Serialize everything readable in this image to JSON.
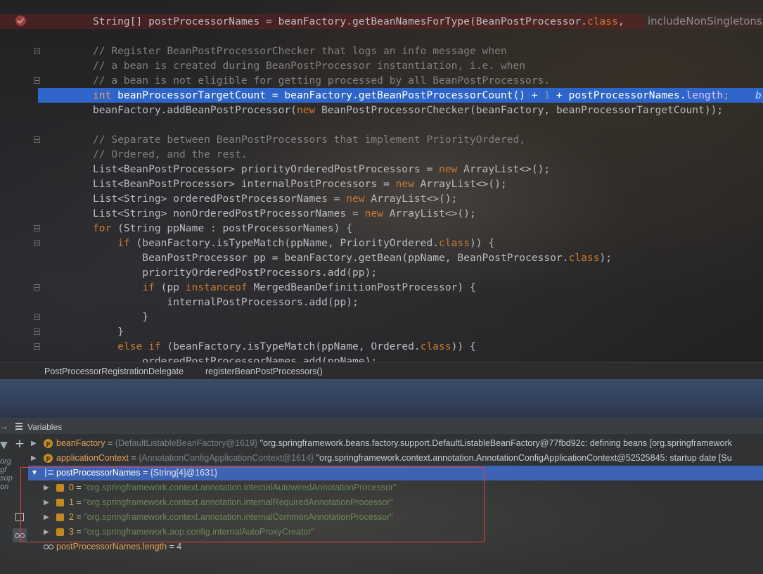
{
  "editor": {
    "lines": [
      {
        "segments": [
          {
            "t": "String[] postProcessorNames = beanFactory.getBeanNamesForType(BeanPostProcessor."
          },
          {
            "t": "class",
            "c": "kw"
          },
          {
            "t": ", "
          }
        ],
        "hint": "includeNonSingletons"
      },
      {
        "segments": []
      },
      {
        "segments": [
          {
            "t": "// Register BeanPostProcessorChecker that logs an info message when",
            "c": "cm"
          }
        ]
      },
      {
        "segments": [
          {
            "t": "// a bean is created during BeanPostProcessor instantiation, i.e. when",
            "c": "cm"
          }
        ]
      },
      {
        "segments": [
          {
            "t": "// a bean is not eligible for getting processed by all BeanPostProcessors.",
            "c": "cm"
          }
        ]
      },
      {
        "segments": [
          {
            "t": "int",
            "c": "kw"
          },
          {
            "t": " beanProcessorTargetCount = beanFactory.getBeanPostProcessorCount() + "
          },
          {
            "t": "1",
            "c": "num"
          },
          {
            "t": " + postProcessorNames."
          },
          {
            "t": "length",
            "c": "field"
          },
          {
            "t": ";",
            "c": "kw"
          }
        ],
        "hint_tail": "b"
      },
      {
        "segments": [
          {
            "t": "beanFactory.addBeanPostProcessor("
          },
          {
            "t": "new",
            "c": "kw"
          },
          {
            "t": " BeanPostProcessorChecker(beanFactory, beanProcessorTargetCount));"
          }
        ]
      },
      {
        "segments": []
      },
      {
        "segments": [
          {
            "t": "// Separate between BeanPostProcessors that implement PriorityOrdered,",
            "c": "cm"
          }
        ]
      },
      {
        "segments": [
          {
            "t": "// Ordered, and the rest.",
            "c": "cm"
          }
        ]
      },
      {
        "segments": [
          {
            "t": "List<BeanPostProcessor> priorityOrderedPostProcessors = "
          },
          {
            "t": "new",
            "c": "kw"
          },
          {
            "t": " ArrayList<>();"
          }
        ]
      },
      {
        "segments": [
          {
            "t": "List<BeanPostProcessor> internalPostProcessors = "
          },
          {
            "t": "new",
            "c": "kw"
          },
          {
            "t": " ArrayList<>();"
          }
        ]
      },
      {
        "segments": [
          {
            "t": "List<String> orderedPostProcessorNames = "
          },
          {
            "t": "new",
            "c": "kw"
          },
          {
            "t": " ArrayList<>();"
          }
        ]
      },
      {
        "segments": [
          {
            "t": "List<String> nonOrderedPostProcessorNames = "
          },
          {
            "t": "new",
            "c": "kw"
          },
          {
            "t": " ArrayList<>();"
          }
        ]
      },
      {
        "segments": [
          {
            "t": "for",
            "c": "kw"
          },
          {
            "t": " (String ppName : postProcessorNames) {"
          }
        ]
      },
      {
        "segments": [
          {
            "t": "    "
          },
          {
            "t": "if",
            "c": "kw"
          },
          {
            "t": " (beanFactory.isTypeMatch(ppName, PriorityOrdered."
          },
          {
            "t": "class",
            "c": "kw"
          },
          {
            "t": ")) {"
          }
        ]
      },
      {
        "segments": [
          {
            "t": "        BeanPostProcessor pp = beanFactory.getBean(ppName, BeanPostProcessor."
          },
          {
            "t": "class",
            "c": "kw"
          },
          {
            "t": ");"
          }
        ]
      },
      {
        "segments": [
          {
            "t": "        priorityOrderedPostProcessors.add(pp);"
          }
        ]
      },
      {
        "segments": [
          {
            "t": "        "
          },
          {
            "t": "if",
            "c": "kw"
          },
          {
            "t": " (pp "
          },
          {
            "t": "instanceof",
            "c": "kw"
          },
          {
            "t": " MergedBeanDefinitionPostProcessor) {"
          }
        ]
      },
      {
        "segments": [
          {
            "t": "            internalPostProcessors.add(pp);"
          }
        ]
      },
      {
        "segments": [
          {
            "t": "        }"
          }
        ]
      },
      {
        "segments": [
          {
            "t": "    }"
          }
        ]
      },
      {
        "segments": [
          {
            "t": "    "
          },
          {
            "t": "else if",
            "c": "kw"
          },
          {
            "t": " (beanFactory.isTypeMatch(ppName, Ordered."
          },
          {
            "t": "class",
            "c": "kw"
          },
          {
            "t": ")) {"
          }
        ]
      },
      {
        "segments": [
          {
            "t": "        orderedPostProcessorNames.add(ppName);"
          }
        ]
      }
    ]
  },
  "breadcrumb": {
    "class_name": "PostProcessorRegistrationDelegate",
    "method_name": "registerBeanPostProcessors()"
  },
  "variables_panel": {
    "title": "Variables",
    "header_arrow": "→"
  },
  "variables": {
    "bean_factory": {
      "name": "beanFactory",
      "type": "{DefaultListableBeanFactory@1619}",
      "value": "\"org.springframework.beans.factory.support.DefaultListableBeanFactory@77fbd92c: defining beans [org.springframework"
    },
    "application_context": {
      "name": "applicationContext",
      "type": "{AnnotationConfigApplicationContext@1614}",
      "value": "\"org.springframework.context.annotation.AnnotationConfigApplicationContext@52525845: startup date [Su"
    },
    "post_processor_names": {
      "name": "postProcessorNames",
      "type": "{String[4]@1631}"
    },
    "elements": [
      {
        "index": "0",
        "value": "\"org.springframework.context.annotation.internalAutowiredAnnotationProcessor\""
      },
      {
        "index": "1",
        "value": "\"org.springframework.context.annotation.internalRequiredAnnotationProcessor\""
      },
      {
        "index": "2",
        "value": "\"org.springframework.context.annotation.internalCommonAnnotationProcessor\""
      },
      {
        "index": "3",
        "value": "\"org.springframework.aop.config.internalAutoProxyCreator\""
      }
    ],
    "watch": {
      "name": "postProcessorNames.length",
      "value": "4"
    }
  },
  "left_sliver_text": [
    "org",
    "gf",
    "sup",
    "on"
  ],
  "icons": {
    "breakpoint": "breakpoint-check-icon",
    "add": "plus-icon",
    "copy": "copy-icon",
    "watch": "glasses-icon",
    "filter": "funnel-icon"
  },
  "colors": {
    "execution_line": "#2f65ca",
    "selected_row": "#3d63b5",
    "highlight_box": "#e0403a",
    "keyword": "#cc7832",
    "string": "#6a8759",
    "comment": "#808080"
  }
}
